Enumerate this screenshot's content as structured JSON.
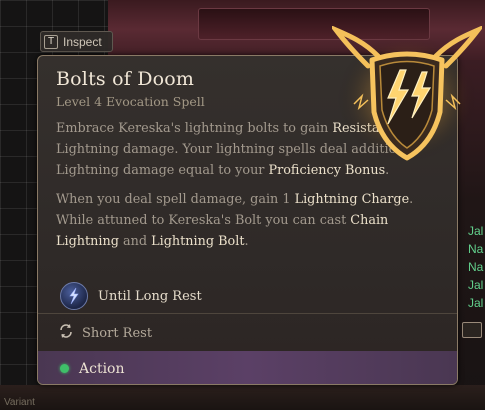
{
  "inspect": {
    "key": "T",
    "label": "Inspect"
  },
  "tooltip": {
    "title": "Bolts of Doom",
    "subtitle": "Level 4 Evocation Spell",
    "paragraph1": [
      {
        "text": "Embrace Kereska's lightning bolts to gain ",
        "highlight": false
      },
      {
        "text": "Resistance",
        "highlight": true
      },
      {
        "text": " to Lightning damage. Your lightning spells deal additional Lightning damage equal to your ",
        "highlight": false
      },
      {
        "text": "Proficiency Bonus",
        "highlight": true
      },
      {
        "text": ".",
        "highlight": false
      }
    ],
    "paragraph2": [
      {
        "text": "When you deal spell damage, gain 1 ",
        "highlight": false
      },
      {
        "text": "Lightning Charge",
        "highlight": true
      },
      {
        "text": ". While attuned to Kereska's Bolt you can cast ",
        "highlight": false
      },
      {
        "text": "Chain Lightning",
        "highlight": true
      },
      {
        "text": " and ",
        "highlight": false
      },
      {
        "text": "Lightning Bolt",
        "highlight": true
      },
      {
        "text": ".",
        "highlight": false
      }
    ],
    "duration": "Until Long Rest",
    "recharge": "Short Rest",
    "cost": "Action"
  },
  "side_panel": {
    "names": [
      "Jal",
      "Na",
      "Na",
      "Jal",
      "Jal"
    ]
  },
  "bottom_text": "Variant",
  "colors": {
    "highlight": "#ebe0ca",
    "body_text": "#a39a8e",
    "action_dot": "#3fbf69",
    "party_names": "#62d08c",
    "emblem_gold": "#f4c05a"
  },
  "icons": {
    "inspect_key": "keycap-icon",
    "duration": "lightning-spell-icon",
    "recharge": "refresh-cycle-icon",
    "cost": "action-dot-icon",
    "emblem": "bolts-of-doom-shield-emblem"
  }
}
